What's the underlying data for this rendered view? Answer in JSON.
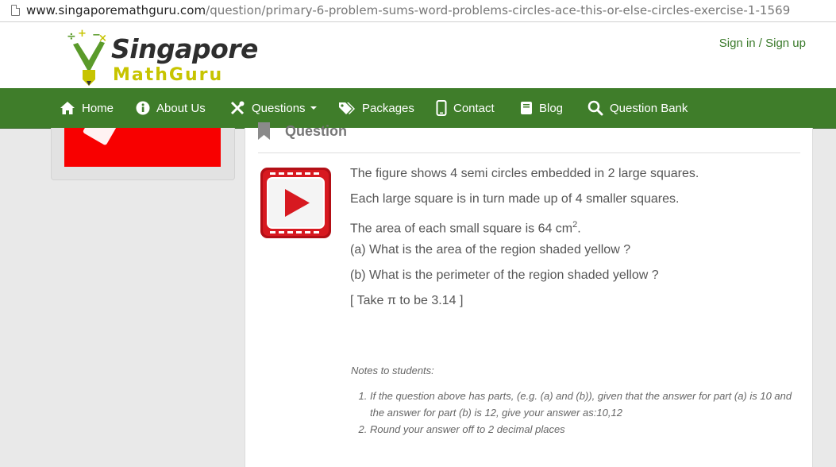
{
  "browser": {
    "url_domain": "www.singaporemathguru.com",
    "url_path": "/question/primary-6-problem-sums-word-problems-circles-ace-this-or-else-circles-exercise-1-1569"
  },
  "header": {
    "logo_word1": "Singapore",
    "logo_word2": "MathGuru",
    "signin_label": "Sign in / Sign up"
  },
  "nav": {
    "items": [
      {
        "label": "Home",
        "icon": "home-icon"
      },
      {
        "label": "About Us",
        "icon": "info-icon"
      },
      {
        "label": "Questions",
        "icon": "tools-icon"
      },
      {
        "label": "Packages",
        "icon": "tags-icon"
      },
      {
        "label": "Contact",
        "icon": "phone-icon"
      },
      {
        "label": "Blog",
        "icon": "book-icon"
      },
      {
        "label": "Question Bank",
        "icon": "search-icon"
      }
    ]
  },
  "question": {
    "heading": "Question",
    "lines": [
      "The figure shows 4 semi circles embedded in 2 large squares.",
      "Each large square is in turn made up of 4 smaller squares.",
      "The area of each small square is 64 cm",
      "(a) What is the area of the region shaded yellow ?",
      "(b) What is the perimeter of the region shaded yellow ?",
      "[ Take π to be 3.14 ]"
    ],
    "area_superscript": "2",
    "area_suffix": "."
  },
  "notes": {
    "title": "Notes to students:",
    "items": [
      "If the question above has parts, (e.g. (a) and (b)), given that the answer for part (a) is 10 and the answer for part (b) is 12, give your answer as:10,12",
      "Round your answer off to 2 decimal places"
    ]
  },
  "colors": {
    "nav_green": "#3f7d2a",
    "link_green": "#3a7a2a",
    "video_red": "#d71920"
  }
}
